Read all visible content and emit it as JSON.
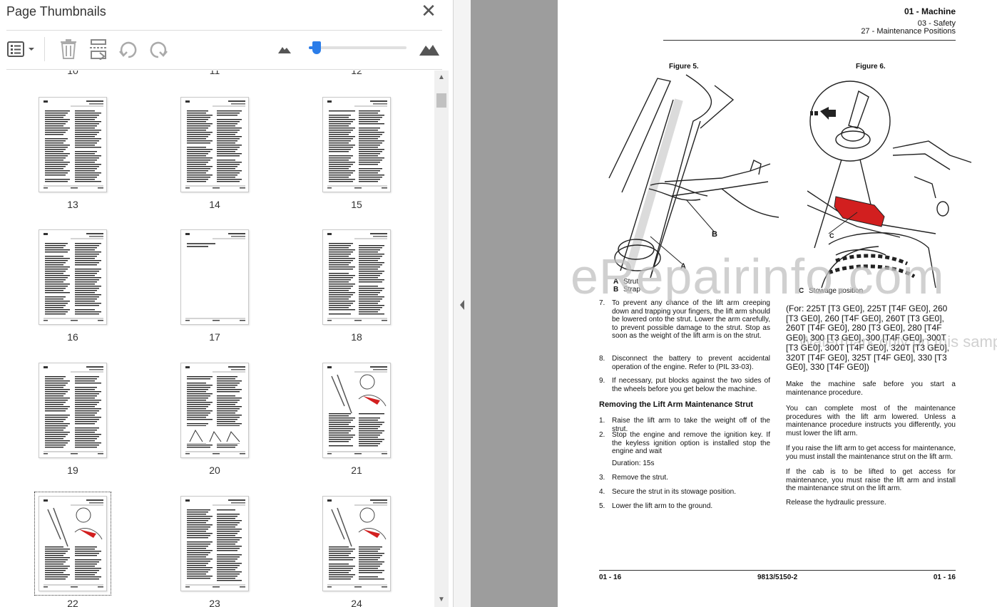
{
  "panel": {
    "title": "Page Thumbnails",
    "close_label": "✕"
  },
  "toolbar": {
    "options_icon": "list-options-icon",
    "delete_icon": "trash-icon",
    "insert_icon": "insert-pages-icon",
    "rotate_ccw_icon": "rotate-counterclockwise-icon",
    "rotate_cw_icon": "rotate-clockwise-icon",
    "zoom_slider_value": 0.08
  },
  "thumbnails": {
    "cut_numbers": [
      "10",
      "11",
      "12"
    ],
    "pages": [
      {
        "label": "13"
      },
      {
        "label": "14"
      },
      {
        "label": "15"
      },
      {
        "label": "16"
      },
      {
        "label": "17"
      },
      {
        "label": "18"
      },
      {
        "label": "19"
      },
      {
        "label": "20"
      },
      {
        "label": "21"
      },
      {
        "label": "22"
      },
      {
        "label": "23"
      },
      {
        "label": "24"
      }
    ],
    "selected": "22"
  },
  "document": {
    "header": {
      "machine": "01 - Machine",
      "safety": "03 - Safety",
      "maintenance": "27 - Maintenance Positions"
    },
    "figure5": "Figure 5.",
    "figure6": "Figure 6.",
    "label_a": "A",
    "label_b": "B",
    "label_c": "C",
    "legend": {
      "a_key": "A",
      "a_text": "Strut",
      "b_key": "B",
      "b_text": "Strap",
      "c_key": "C",
      "c_text": "Stowage position"
    },
    "steps_top": [
      {
        "n": "7.",
        "text": "To prevent any chance of the lift arm creeping down and trapping your fingers, the lift arm should be lowered onto the strut. Lower the arm carefully, to prevent possible damage to the strut. Stop as soon as the weight of the lift arm is on the strut."
      },
      {
        "n": "8.",
        "text": "Disconnect the battery to prevent accidental operation of the engine. Refer to (PIL 33-03)."
      },
      {
        "n": "9.",
        "text": "If necessary, put blocks against the two sides of the wheels before you get below the machine."
      }
    ],
    "removing_heading": "Removing the Lift Arm Maintenance Strut",
    "steps_remove": [
      {
        "n": "1.",
        "text": "Raise the lift arm to take the weight off of the strut."
      },
      {
        "n": "2.",
        "text": "Stop the engine and remove the ignition key. If the keyless ignition option is installed stop the engine and wait"
      },
      {
        "n": "",
        "text": "Duration: 15s"
      },
      {
        "n": "3.",
        "text": "Remove the strut."
      },
      {
        "n": "4.",
        "text": "Secure the strut in its stowage position."
      },
      {
        "n": "5.",
        "text": "Lower the lift arm to the ground."
      }
    ],
    "for_models": "(For: 225T [T3 GE0], 225T [T4F GE0], 260 [T3 GE0], 260 [T4F GE0], 260T [T3 GE0], 260T [T4F GE0], 280 [T3 GE0], 280 [T4F GE0], 300 [T3 GE0], 300 [T4F GE0], 300T [T3 GE0], 300T [T4F GE0], 320T [T3 GE0], 320T [T4F GE0], 325T [T4F GE0], 330 [T3 GE0], 330 [T4F GE0])",
    "right_paras": [
      "Make the machine safe before you start a maintenance procedure.",
      "You can complete most of the maintenance procedures with the lift arm lowered. Unless a maintenance procedure instructs you differently, you must lower the lift arm.",
      "If you raise the lift arm to get access for maintenance, you must install the maintenance strut on the lift arm.",
      "If the cab is to be lifted to get access for maintenance, you must raise the lift arm and install the maintenance strut on the lift arm.",
      "Release the hydraulic pressure."
    ],
    "footer": {
      "left": "01 - 16",
      "middle": "9813/5150-2",
      "right": "01 - 16"
    },
    "watermark_main": "eRepairinfo.com",
    "watermark_sub": "Watermark only on this sample"
  },
  "colors": {
    "accent": "#2b7de9",
    "doc_bg": "#9d9d9d",
    "stowage_red": "#d21f1f"
  }
}
